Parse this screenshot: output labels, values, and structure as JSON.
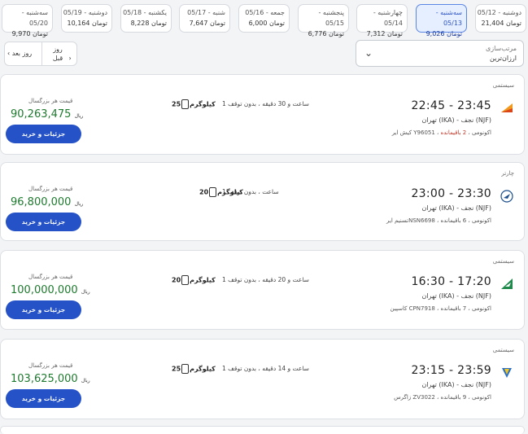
{
  "dates": [
    {
      "day": "دوشنبه - 05/12",
      "price": "21,404 تومان",
      "active": false
    },
    {
      "day": "سه‌شنبه - 05/13",
      "price": "9,026 تومان",
      "active": true
    },
    {
      "day": "چهارشنبه - 05/14",
      "price": "7,312 تومان",
      "active": false
    },
    {
      "day": "پنجشنبه - 05/15",
      "price": "6,776 تومان",
      "active": false
    },
    {
      "day": "جمعه - 05/16",
      "price": "6,000 تومان",
      "active": false
    },
    {
      "day": "شنبه - 05/17",
      "price": "7,647 تومان",
      "active": false
    },
    {
      "day": "یکشنبه - 05/18",
      "price": "8,228 تومان",
      "active": false
    },
    {
      "day": "دوشنبه - 05/19",
      "price": "10,164 تومان",
      "active": false
    },
    {
      "day": "سه‌شنبه - 05/20",
      "price": "9,970 تومان",
      "active": false
    }
  ],
  "sort": {
    "label": "مرتب‌سازی",
    "value": "ارزان‌ترین"
  },
  "pager": {
    "prev": "روز قبل",
    "next": "روز بعد"
  },
  "flights": [
    {
      "type": "سیستمی",
      "time": "22:45 - 23:45",
      "route": "تهران (IKA) - نجف (NJF)",
      "airline": "کیش ایر Y96051 ، اکونومی ،",
      "seats": "2 باقیمانده",
      "duration": "1 ساعت و 30 دقیقه ، بدون توقف",
      "baggage_num": "25",
      "baggage_unit": "کیلوگرم",
      "price_label": "قیمت هر بزرگسال",
      "price": "90,263,475",
      "currency": "ریال",
      "button": "جزئیات و خرید",
      "logo_color": "#f29a1d"
    },
    {
      "type": "چارتر",
      "time": "23:00 - 23:30",
      "route": "تهران (IKA) - نجف (NJF)",
      "airline": "تسنیم ایرNSN6698 ، اکونومی ،",
      "seats": "6 باقیمانده",
      "duration": "1 ساعت ، بدون توقف",
      "baggage_num": "20",
      "baggage_unit": "کیلوگرم",
      "price_label": "قیمت هر بزرگسال",
      "price": "96,800,000",
      "currency": "ریال",
      "button": "جزئیات و خرید",
      "logo_color": "#1b4e8c"
    },
    {
      "type": "سیستمی",
      "time": "16:30 - 17:20",
      "route": "تهران (IKA) - نجف (NJF)",
      "airline": "کاسپین CPN7918 ، اکونومی ،",
      "seats": "7 باقیمانده",
      "duration": "1 ساعت و 20 دقیقه ، بدون توقف",
      "baggage_num": "20",
      "baggage_unit": "کیلوگرم",
      "price_label": "قیمت هر بزرگسال",
      "price": "100,000,000",
      "currency": "ریال",
      "button": "جزئیات و خرید",
      "logo_color": "#1f8a4c"
    },
    {
      "type": "سیستمی",
      "time": "23:15 - 23:59",
      "route": "تهران (IKA) - نجف (NJF)",
      "airline": "زاگرس ZV3022 ، اکونومی ،",
      "seats": "9 باقیمانده",
      "duration": "1 ساعت و 14 دقیقه ، بدون توقف",
      "baggage_num": "25",
      "baggage_unit": "کیلوگرم",
      "price_label": "قیمت هر بزرگسال",
      "price": "103,625,000",
      "currency": "ریال",
      "button": "جزئیات و خرید",
      "logo_color": "#2a6fc4"
    }
  ]
}
